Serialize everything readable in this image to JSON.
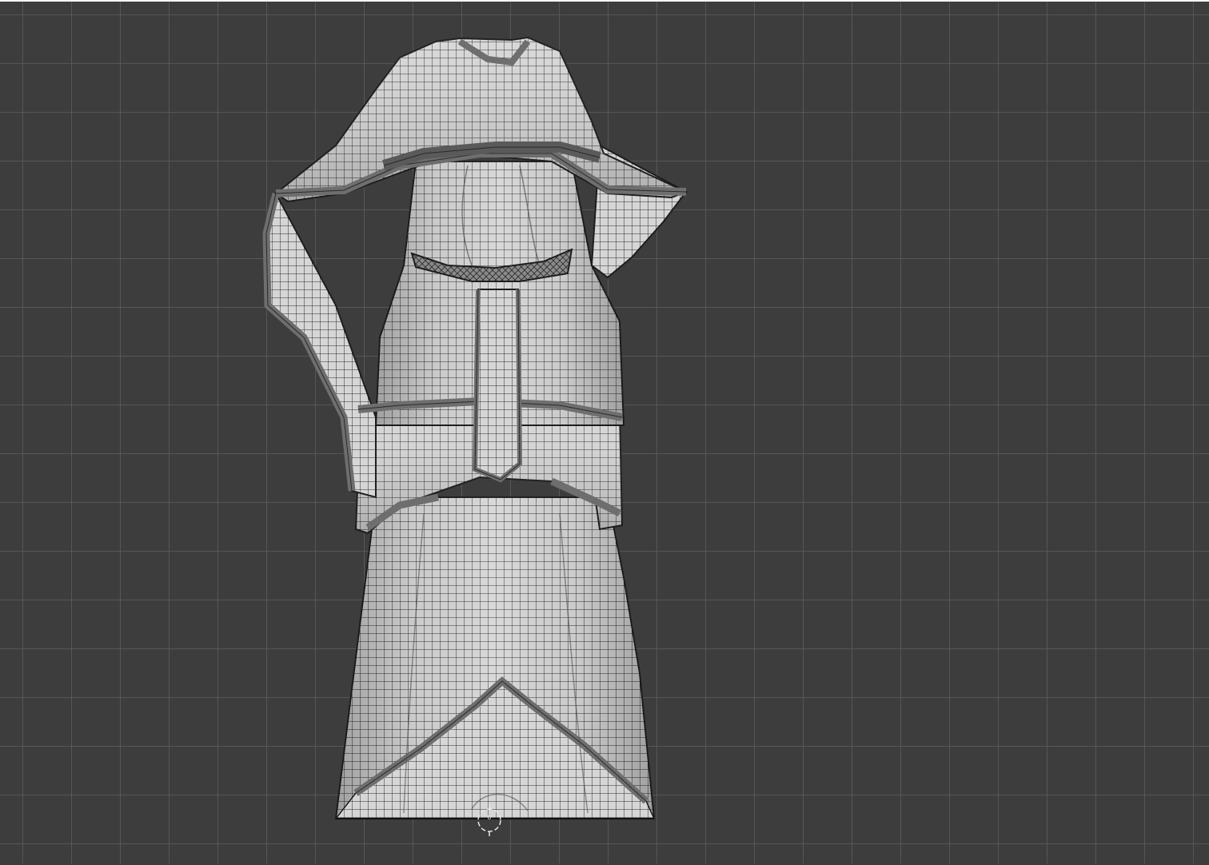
{
  "viewport": {
    "background_color": "#3d3d3d",
    "grid_color": "#5a5a5a",
    "mesh_fill_color": "#d8d8d8",
    "mesh_wire_color": "#2a2a2a",
    "trim_color": "#6e6e6e"
  },
  "model": {
    "type": "garment-wireframe",
    "parts": [
      "cape",
      "tunic",
      "belt",
      "front-panel",
      "peplum",
      "skirt"
    ]
  },
  "origin_gizmo": {
    "icon": "origin-circle-icon",
    "label": "0"
  }
}
